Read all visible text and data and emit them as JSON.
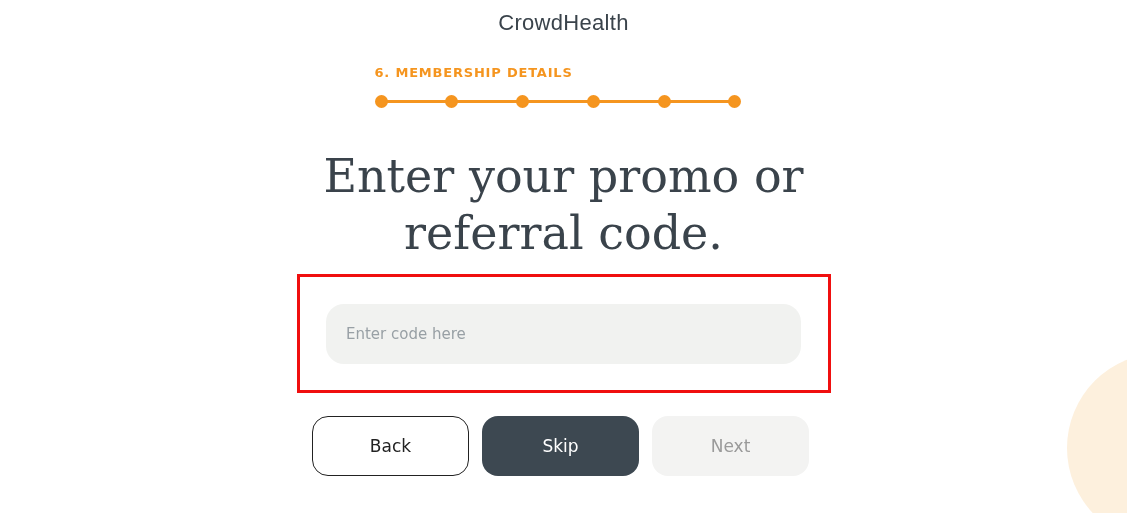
{
  "logo": "CrowdHealth",
  "progress": {
    "label": "6. MEMBERSHIP DETAILS",
    "steps": [
      {
        "done": true
      },
      {
        "done": true
      },
      {
        "done": true
      },
      {
        "done": true
      },
      {
        "done": true
      },
      {
        "done": true
      }
    ]
  },
  "heading": "Enter your promo or referral code.",
  "code_field": {
    "placeholder": "Enter code here",
    "highlighted": true
  },
  "buttons": [
    {
      "label": "Back",
      "kind": "secondary",
      "disabled": false
    },
    {
      "label": "Skip",
      "kind": "primary",
      "disabled": false
    },
    {
      "label": "Next",
      "kind": "primary",
      "disabled": true
    }
  ]
}
